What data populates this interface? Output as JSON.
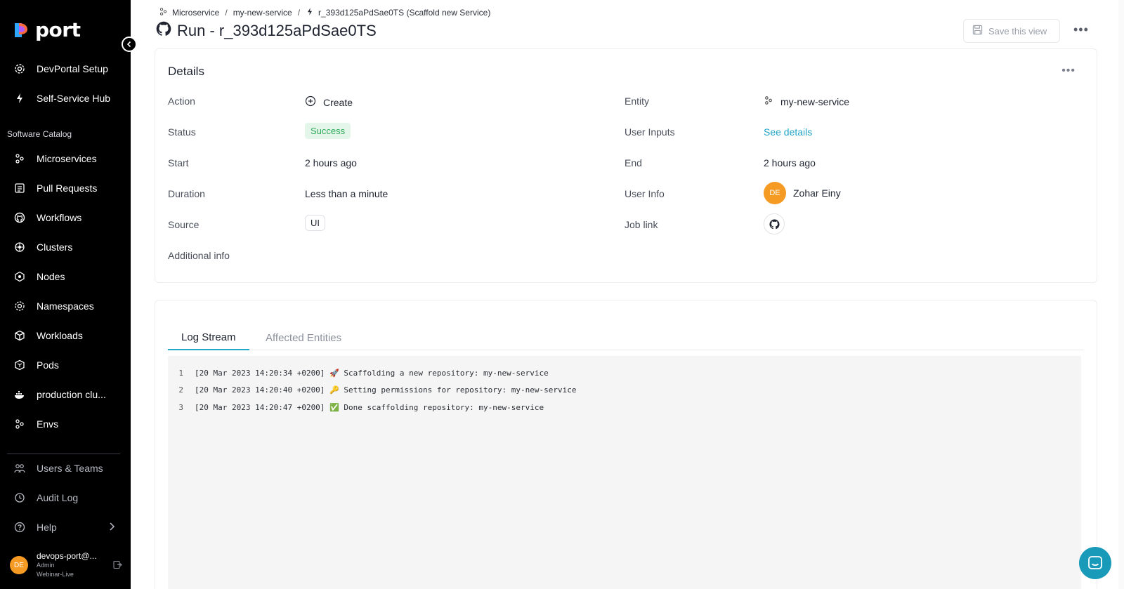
{
  "brand": {
    "name": "port"
  },
  "sidebar": {
    "top_items": [
      {
        "label": "DevPortal Setup",
        "icon": "gear-icon"
      },
      {
        "label": "Self-Service Hub",
        "icon": "lightning-icon"
      }
    ],
    "section_label": "Software Catalog",
    "catalog_items": [
      {
        "label": "Microservices",
        "icon": "microservice-icon"
      },
      {
        "label": "Pull Requests",
        "icon": "list-icon"
      },
      {
        "label": "Workflows",
        "icon": "github-icon"
      },
      {
        "label": "Clusters",
        "icon": "helm-icon"
      },
      {
        "label": "Nodes",
        "icon": "node-icon"
      },
      {
        "label": "Namespaces",
        "icon": "namespace-icon"
      },
      {
        "label": "Workloads",
        "icon": "cube-icon"
      },
      {
        "label": "Pods",
        "icon": "pod-icon"
      },
      {
        "label": "production clu...",
        "icon": "docker-icon"
      },
      {
        "label": "Envs",
        "icon": "microservice-icon"
      }
    ],
    "bottom_items": [
      {
        "label": "Users & Teams",
        "icon": "users-icon"
      },
      {
        "label": "Audit Log",
        "icon": "history-icon"
      },
      {
        "label": "Help",
        "icon": "help-icon"
      }
    ],
    "user": {
      "initials": "DE",
      "email": "devops-port@...",
      "role": "Admin",
      "org": "Webinar-Live"
    }
  },
  "breadcrumb": {
    "items": [
      "Microservice",
      "my-new-service",
      "r_393d125aPdSae0TS (Scaffold new Service)"
    ],
    "separator": "/"
  },
  "header": {
    "title": "Run - r_393d125aPdSae0TS",
    "save_label": "Save this view"
  },
  "details": {
    "title": "Details",
    "left": [
      {
        "label": "Action",
        "value": "Create"
      },
      {
        "label": "Status",
        "value": "Success"
      },
      {
        "label": "Start",
        "value": "2 hours ago"
      },
      {
        "label": "Duration",
        "value": "Less than a minute"
      },
      {
        "label": "Source",
        "value": "UI"
      },
      {
        "label": "Additional info",
        "value": ""
      }
    ],
    "right": [
      {
        "label": "Entity",
        "value": "my-new-service"
      },
      {
        "label": "User Inputs",
        "value": "See details"
      },
      {
        "label": "End",
        "value": "2 hours ago"
      },
      {
        "label": "User Info",
        "value": "Zohar Einy",
        "initials": "DE"
      },
      {
        "label": "Job link",
        "value": ""
      }
    ]
  },
  "log": {
    "tabs": [
      "Log Stream",
      "Affected Entities"
    ],
    "active_tab": "Log Stream",
    "lines": [
      {
        "num": "1",
        "text": "[20 Mar 2023 14:20:34 +0200] 🚀 Scaffolding a new repository: my-new-service"
      },
      {
        "num": "2",
        "text": "[20 Mar 2023 14:20:40 +0200] 🔑 Setting permissions for repository: my-new-service"
      },
      {
        "num": "3",
        "text": "[20 Mar 2023 14:20:47 +0200] ✅ Done scaffolding repository: my-new-service"
      }
    ]
  },
  "colors": {
    "sidebar_bg": "#000000",
    "accent": "#22a8c9",
    "success": "#2fa85a",
    "avatar": "#f59a23"
  }
}
